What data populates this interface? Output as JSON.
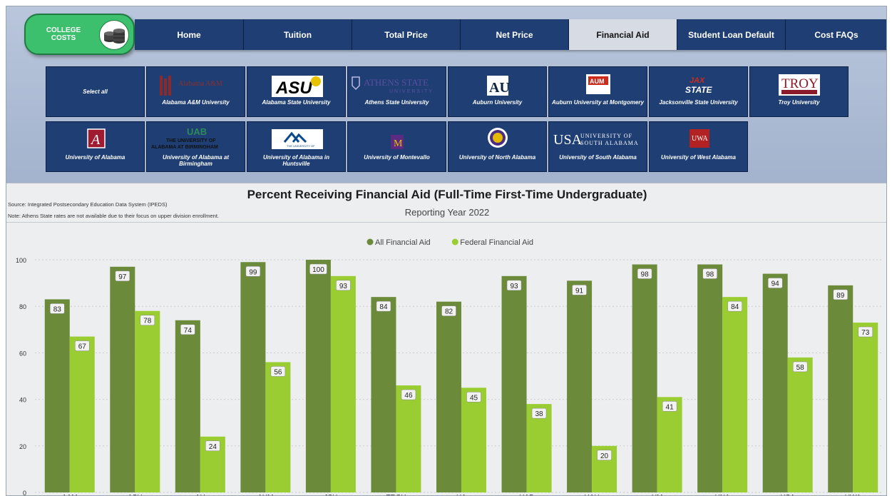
{
  "logo": {
    "line1": "COLLEGE",
    "line2": "COSTS"
  },
  "nav": [
    {
      "label": "Home",
      "active": false
    },
    {
      "label": "Tuition",
      "active": false
    },
    {
      "label": "Total Price",
      "active": false
    },
    {
      "label": "Net Price",
      "active": false
    },
    {
      "label": "Financial Aid",
      "active": true
    },
    {
      "label": "Student Loan Default",
      "active": false
    },
    {
      "label": "Cost FAQs",
      "active": false
    }
  ],
  "universities": [
    {
      "name": "Select all",
      "logo": ""
    },
    {
      "name": "Alabama A&M University",
      "logo": "Alabama A&M"
    },
    {
      "name": "Alabama State University",
      "logo": "ASU"
    },
    {
      "name": "Athens State University",
      "logo": "ATHENS STATE"
    },
    {
      "name": "Auburn University",
      "logo": "AU"
    },
    {
      "name": "Auburn University at Montgomery",
      "logo": "AUM"
    },
    {
      "name": "Jacksonville State University",
      "logo": "JAX STATE"
    },
    {
      "name": "Troy University",
      "logo": "TROY"
    },
    {
      "name": "University of Alabama",
      "logo": "A"
    },
    {
      "name": "University of Alabama at Birmingham",
      "logo": "UAB"
    },
    {
      "name": "University of Alabama in Huntsville",
      "logo": "UAH"
    },
    {
      "name": "University of Montevallo",
      "logo": "M"
    },
    {
      "name": "University of North Alabama",
      "logo": "UNA"
    },
    {
      "name": "University of South Alabama",
      "logo": "USA"
    },
    {
      "name": "University of West Alabama",
      "logo": "UWA"
    }
  ],
  "notes": {
    "source": "Source: Integrated Postsecondary Education Data System (IPEDS)",
    "athens": "Note:  Athens State rates are not available due to their focus on upper division enrollment."
  },
  "colors": {
    "all_aid": "#6b8a3a",
    "federal_aid": "#9acd32",
    "nav": "#1f3e74",
    "nav_active": "#d6dbe4"
  },
  "chart_data": {
    "type": "bar",
    "title": "Percent Receiving Financial Aid (Full-Time First-Time Undergraduate)",
    "subtitle": "Reporting Year 2022",
    "categories": [
      "AAM",
      "ASU",
      "AU",
      "AUM",
      "JSU",
      "TROY",
      "UA",
      "UAB",
      "UAH",
      "UM",
      "UNA",
      "USA",
      "UWA"
    ],
    "series": [
      {
        "name": "All Financial Aid",
        "color": "#6b8a3a",
        "values": [
          83,
          97,
          74,
          99,
          100,
          84,
          82,
          93,
          91,
          98,
          98,
          94,
          89
        ]
      },
      {
        "name": "Federal Financial Aid",
        "color": "#9acd32",
        "values": [
          67,
          78,
          24,
          56,
          93,
          46,
          45,
          38,
          20,
          41,
          84,
          58,
          73
        ]
      }
    ],
    "ylim": [
      0,
      100
    ],
    "yticks": [
      0,
      20,
      40,
      60,
      80,
      100
    ],
    "grid": true,
    "legend_position": "top-center"
  }
}
